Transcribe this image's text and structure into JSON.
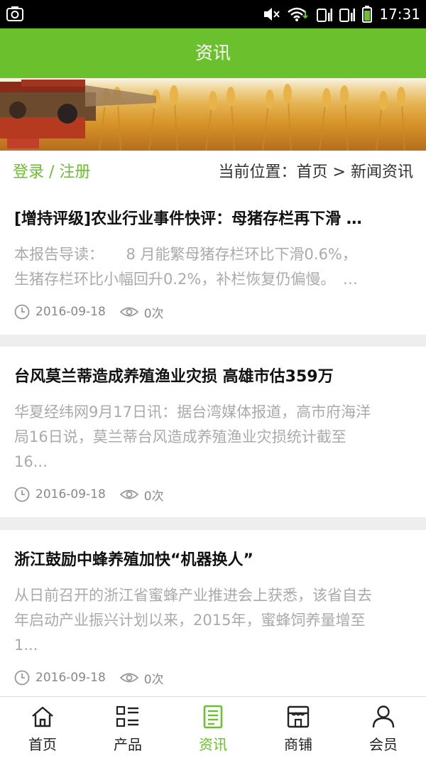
{
  "status_bar": {
    "time": "17:31"
  },
  "header": {
    "title": "资讯"
  },
  "auth": {
    "login": "登录",
    "separator": "/",
    "register": "注册"
  },
  "breadcrumb": {
    "prefix": "当前位置：",
    "home": "首页",
    "sep": ">",
    "current": "新闻资讯"
  },
  "articles": [
    {
      "title": "[增持评级]农业行业事件快评：母猪存栏再下滑 …",
      "excerpt_line1": "本报告导读：　　8 月能繁母猪存栏环比下滑0.6%，",
      "excerpt_line2": "生猪存栏环比小幅回升0.2%，补栏恢复仍偏慢。　…",
      "date": "2016-09-18",
      "views": "0次"
    },
    {
      "title": "台风莫兰蒂造成养殖渔业灾损 高雄市估359万",
      "excerpt_line1": "华夏经纬网9月17日讯：据台湾媒体报道，高市府海洋",
      "excerpt_line2": "局16日说，莫兰蒂台风造成养殖渔业灾损统计截至",
      "excerpt_line3": "16...",
      "date": "2016-09-18",
      "views": "0次"
    },
    {
      "title": "浙江鼓励中蜂养殖加快“机器换人”",
      "excerpt_line1": "从日前召开的浙江省蜜蜂产业推进会上获悉，该省自去",
      "excerpt_line2": "年启动产业振兴计划以来，2015年，蜜蜂饲养量增至",
      "excerpt_line3": "1...",
      "date": "2016-09-18",
      "views": "0次"
    }
  ],
  "tabs": [
    {
      "label": "首页",
      "icon": "home-icon",
      "active": false
    },
    {
      "label": "产品",
      "icon": "grid-list-icon",
      "active": false
    },
    {
      "label": "资讯",
      "icon": "document-icon",
      "active": true
    },
    {
      "label": "商铺",
      "icon": "shop-icon",
      "active": false
    },
    {
      "label": "会员",
      "icon": "user-icon",
      "active": false
    }
  ],
  "colors": {
    "accent": "#6ac12d",
    "excerpt": "#aaaaaa"
  }
}
